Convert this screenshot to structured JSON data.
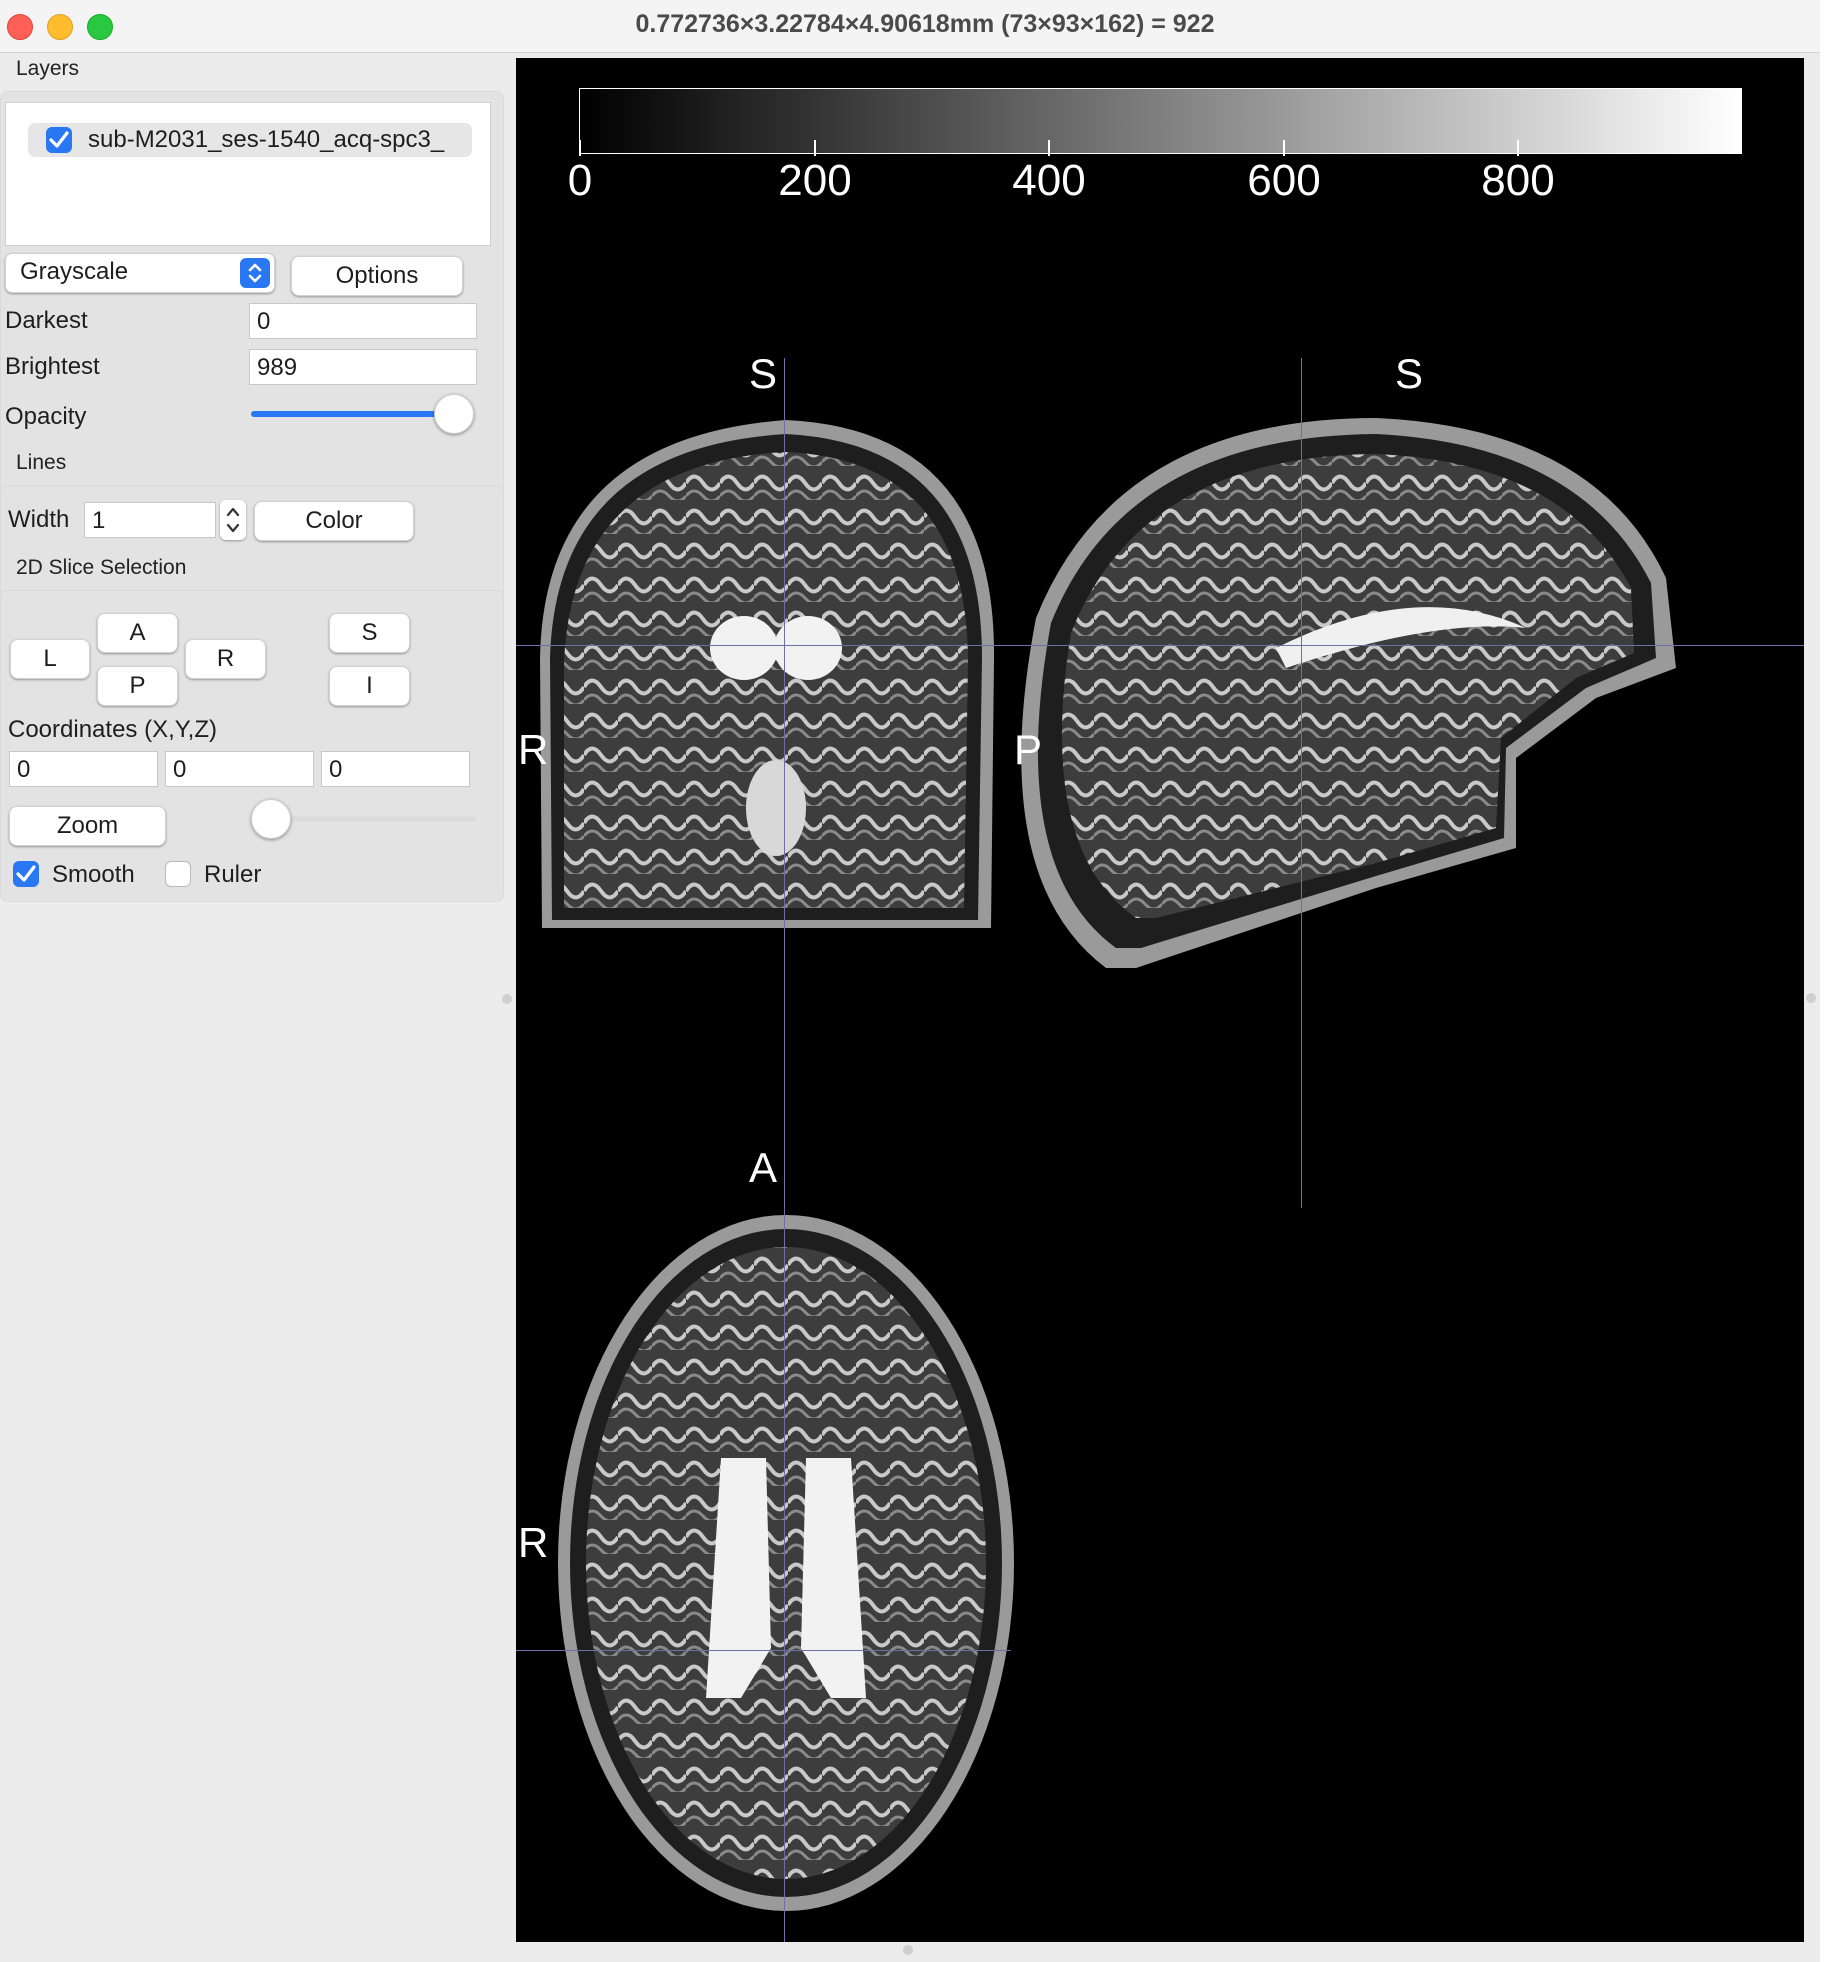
{
  "window": {
    "title": "0.772736×3.22784×4.90618mm (73×93×162) =  922"
  },
  "layers": {
    "group_label": "Layers",
    "items": [
      {
        "name": "sub-M2031_ses-1540_acq-spc3_",
        "checked": true
      }
    ],
    "colormap": "Grayscale",
    "options_label": "Options",
    "darkest_label": "Darkest",
    "darkest_value": "0",
    "brightest_label": "Brightest",
    "brightest_value": "989",
    "opacity_label": "Opacity",
    "opacity_value": 1.0
  },
  "lines": {
    "group_label": "Lines",
    "width_label": "Width",
    "width_value": "1",
    "color_label": "Color"
  },
  "slice_selection": {
    "group_label": "2D Slice Selection",
    "buttons": {
      "L": "L",
      "A": "A",
      "P": "P",
      "R": "R",
      "S": "S",
      "I": "I"
    },
    "coords_label": "Coordinates (X,Y,Z)",
    "x": "0",
    "y": "0",
    "z": "0",
    "zoom_label": "Zoom",
    "zoom_value": 0.0,
    "smooth_label": "Smooth",
    "smooth_checked": true,
    "ruler_label": "Ruler",
    "ruler_checked": false
  },
  "viewer": {
    "colorbar_ticks": [
      "0",
      "200",
      "400",
      "600",
      "800"
    ],
    "coronal": {
      "top": "S",
      "left": "R"
    },
    "sagittal": {
      "top": "S",
      "left": "P"
    },
    "axial": {
      "top": "A",
      "left": "R"
    },
    "crosshair_color": "#6e6ea8"
  }
}
